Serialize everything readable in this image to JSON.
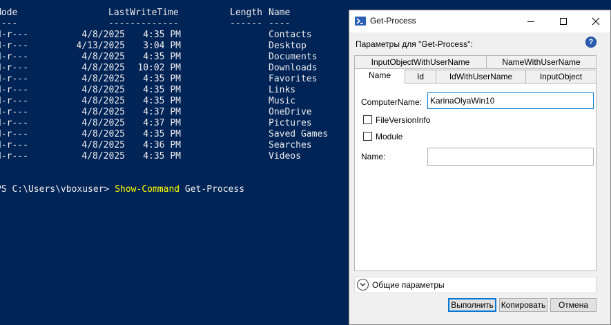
{
  "console": {
    "header": {
      "mode": "Mode",
      "lastwritetime": "LastWriteTime",
      "length": "Length",
      "name": "Name"
    },
    "separator": {
      "mode": "----",
      "lastwritetime": "-------------",
      "length": "------",
      "name": "----"
    },
    "rows": [
      {
        "mode": "d-r---",
        "date": "4/8/2025",
        "time": "4:35 PM",
        "name": "Contacts"
      },
      {
        "mode": "d-r---",
        "date": "4/13/2025",
        "time": "3:04 PM",
        "name": "Desktop"
      },
      {
        "mode": "d-r---",
        "date": "4/8/2025",
        "time": "4:35 PM",
        "name": "Documents"
      },
      {
        "mode": "d-r---",
        "date": "4/8/2025",
        "time": "10:02 PM",
        "name": "Downloads"
      },
      {
        "mode": "d-r---",
        "date": "4/8/2025",
        "time": "4:35 PM",
        "name": "Favorites"
      },
      {
        "mode": "d-r---",
        "date": "4/8/2025",
        "time": "4:35 PM",
        "name": "Links"
      },
      {
        "mode": "d-r---",
        "date": "4/8/2025",
        "time": "4:35 PM",
        "name": "Music"
      },
      {
        "mode": "d-r---",
        "date": "4/8/2025",
        "time": "4:37 PM",
        "name": "OneDrive"
      },
      {
        "mode": "d-r---",
        "date": "4/8/2025",
        "time": "4:37 PM",
        "name": "Pictures"
      },
      {
        "mode": "d-r---",
        "date": "4/8/2025",
        "time": "4:35 PM",
        "name": "Saved Games"
      },
      {
        "mode": "d-r---",
        "date": "4/8/2025",
        "time": "4:36 PM",
        "name": "Searches"
      },
      {
        "mode": "d-r---",
        "date": "4/8/2025",
        "time": "4:35 PM",
        "name": "Videos"
      }
    ],
    "prompt": "PS C:\\Users\\vboxuser> ",
    "command": "Show-Command",
    "argument": " Get-Process"
  },
  "dialog": {
    "title": "Get-Process",
    "params_label": "Параметры для \"Get-Process\":",
    "help_glyph": "?",
    "tabs_back": [
      "InputObjectWithUserName",
      "NameWithUserName"
    ],
    "tabs_front": [
      "Name",
      "Id",
      "IdWithUserName",
      "InputObject"
    ],
    "computername_label": "ComputerName:",
    "computername_value": "KarinaOlyaWin10",
    "fileversioninfo_label": "FileVersionInfo",
    "module_label": "Module",
    "name_label": "Name:",
    "name_value": "",
    "common_params_label": "Общие параметры",
    "buttons": {
      "run": "Выполнить",
      "copy": "Копировать",
      "cancel": "Отмена"
    }
  },
  "colors": {
    "console_bg": "#012456",
    "console_text": "#eeedf0",
    "command_highlight": "#ffff00",
    "accent": "#0078d7"
  }
}
